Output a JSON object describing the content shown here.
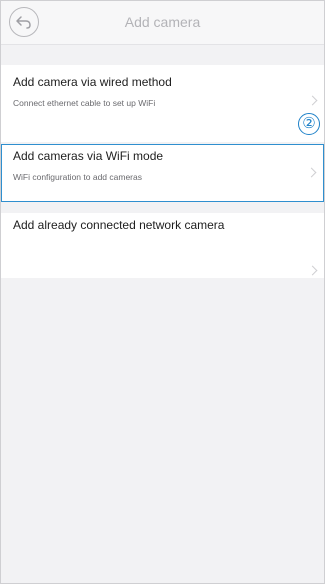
{
  "header": {
    "title": "Add camera",
    "back_icon": "back-arrow-icon"
  },
  "options": [
    {
      "title": "Add camera via wired method",
      "subtitle": "Connect ethernet cable to set up WiFi"
    },
    {
      "title": "Add cameras via WiFi mode",
      "subtitle": "WiFi configuration to add cameras"
    },
    {
      "title": "Add already connected network camera",
      "subtitle": ""
    }
  ],
  "annotation": {
    "step_number": "②"
  },
  "colors": {
    "highlight_border": "#2f8fcf",
    "annotation": "#1f82c9",
    "background": "#f2f2f4"
  }
}
